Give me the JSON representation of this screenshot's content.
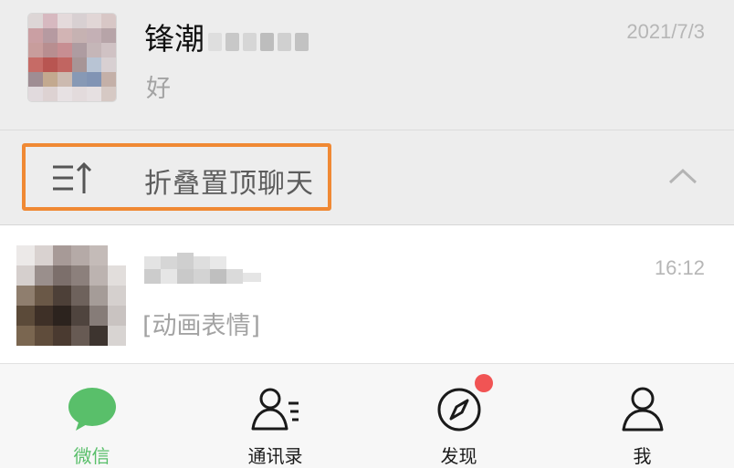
{
  "pinned_chat": {
    "name": "锋潮",
    "time": "2021/7/3",
    "preview": "好"
  },
  "fold_bar": {
    "label": "折叠置顶聊天"
  },
  "recent_chat": {
    "time": "16:12",
    "preview": "[动画表情]"
  },
  "tabbar": {
    "tabs": [
      {
        "label": "微信",
        "icon": "chat-bubble-icon",
        "active": true
      },
      {
        "label": "通讯录",
        "icon": "contacts-icon",
        "active": false
      },
      {
        "label": "发现",
        "icon": "compass-icon",
        "active": false,
        "badge": "red-dot"
      },
      {
        "label": "我",
        "icon": "profile-icon",
        "active": false
      }
    ]
  },
  "colors": {
    "accent_green": "#59bf6a",
    "highlight_orange": "#f08934",
    "badge_red": "#f15454",
    "pinned_bg": "#ededed"
  }
}
